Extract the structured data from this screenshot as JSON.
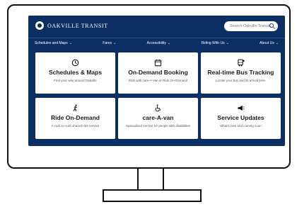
{
  "header": {
    "brand_text": "OAKVILLE TRANSIT",
    "search_placeholder": "Search Oakville Transit"
  },
  "nav": {
    "items": [
      {
        "label": "Schedules and Maps"
      },
      {
        "label": "Fares"
      },
      {
        "label": "Accessibility"
      },
      {
        "label": "Riding With Us"
      },
      {
        "label": "About Us"
      }
    ]
  },
  "cards": [
    {
      "title": "Schedules & Maps",
      "desc": "Find your way around Oakville",
      "icon": "clock-icon"
    },
    {
      "title": "On-Demand Booking",
      "desc": "Ride with care-A-van or Ride On-Demand",
      "icon": "calendar-icon"
    },
    {
      "title": "Real-time Bus Tracking",
      "desc": "Locate your bus and its arrival time.",
      "icon": "bus-icon"
    },
    {
      "title": "Ride On-Demand",
      "desc": "A curb-to-curb shared-ride service",
      "icon": "running-person-icon"
    },
    {
      "title": "care-A-van",
      "desc": "Specialized service for people with disabilities",
      "icon": "wheelchair-icon"
    },
    {
      "title": "Service Updates",
      "desc": "What's new and coming soon",
      "icon": "megaphone-icon"
    }
  ],
  "colors": {
    "brand_navy": "#0b2e63",
    "card_bg": "#ffffff"
  }
}
